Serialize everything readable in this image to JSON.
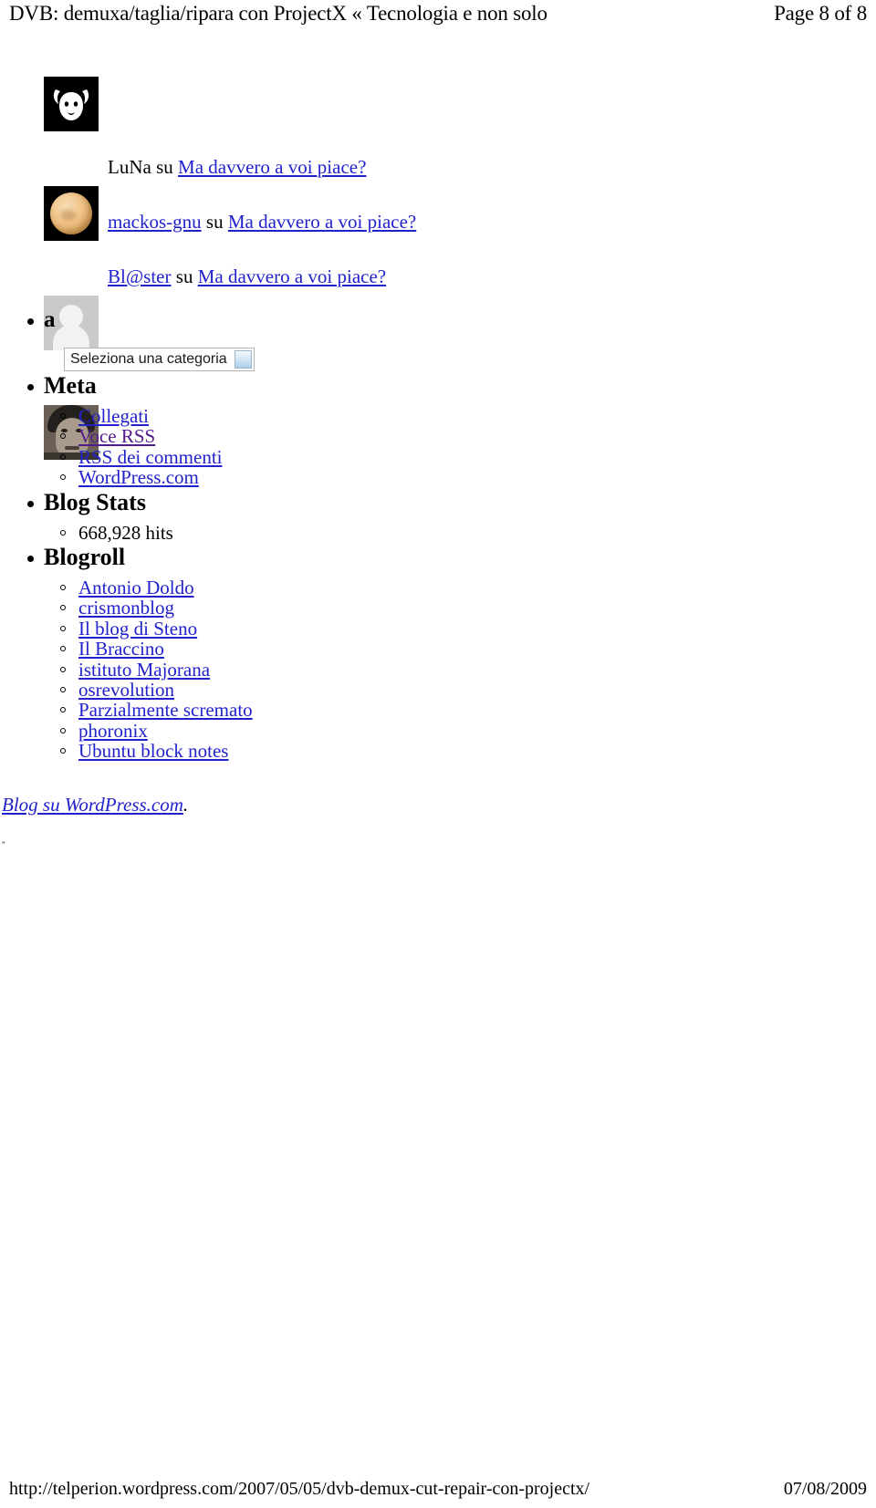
{
  "print_header": {
    "title": "DVB: demuxa/taglia/ripara con ProjectX « Tecnologia e non solo",
    "page_label": "Page 8 of 8"
  },
  "print_footer": {
    "url": "http://telperion.wordpress.com/2007/05/05/dvb-demux-cut-repair-con-projectx/",
    "date": "07/08/2009"
  },
  "recent_comments": {
    "avatars": [
      {
        "name": "gnu-head-avatar",
        "glyph": "\u0001"
      },
      {
        "name": "moon-avatar"
      },
      {
        "name": "default-gray-avatar"
      },
      {
        "name": "photo-avatar"
      }
    ],
    "entries": [
      {
        "author": "LuNa",
        "author_is_link": false,
        "connector": "su",
        "post_title": "Ma davvero a voi piace?"
      },
      {
        "author": "mackos-gnu",
        "author_is_link": true,
        "connector": "su",
        "post_title": "Ma davvero a voi piace?"
      },
      {
        "author": "Bl@ster",
        "author_is_link": true,
        "connector": "su",
        "post_title": "Ma davvero a voi piace?"
      }
    ]
  },
  "widgets": [
    {
      "id": "categories",
      "title": "a",
      "select": {
        "selected_label": "Seleziona una categoria"
      }
    },
    {
      "id": "meta",
      "title": "Meta",
      "links": [
        {
          "label": "Collegati",
          "visited": false
        },
        {
          "label": "Voce RSS",
          "visited": true
        },
        {
          "label": "RSS dei commenti",
          "visited": false
        },
        {
          "label": "WordPress.com",
          "visited": false
        }
      ]
    },
    {
      "id": "blog-stats",
      "title": "Blog Stats",
      "items": [
        {
          "label": "668,928 hits",
          "is_link": false
        }
      ]
    },
    {
      "id": "blogroll",
      "title": "Blogroll",
      "links": [
        {
          "label": "Antonio Doldo",
          "visited": false
        },
        {
          "label": "crismonblog",
          "visited": false
        },
        {
          "label": "Il blog di Steno",
          "visited": false
        },
        {
          "label": "Il Braccino",
          "visited": false
        },
        {
          "label": "istituto Majorana",
          "visited": false
        },
        {
          "label": "osrevolution",
          "visited": false
        },
        {
          "label": "Parzialmente scremato",
          "visited": false
        },
        {
          "label": "phoronix",
          "visited": false
        },
        {
          "label": "Ubuntu block notes",
          "visited": false
        }
      ]
    }
  ],
  "credit": {
    "link_text": "Blog su WordPress.com",
    "period": "."
  },
  "stray_mark": "\"",
  "colors": {
    "link": "#2222cc",
    "visited_link": "#551a8b",
    "text": "#000000",
    "background": "#ffffff",
    "select_border": "#b4b4b4",
    "select_arrow": "#aecfe8"
  }
}
